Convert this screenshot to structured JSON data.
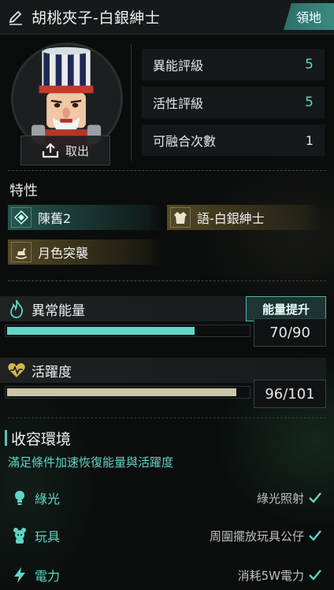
{
  "header": {
    "title": "胡桃夾子-白銀紳士",
    "territory_button": "領地"
  },
  "portrait": {
    "export_label": "取出"
  },
  "stats": [
    {
      "label": "異能評級",
      "value": "5",
      "accent": true
    },
    {
      "label": "活性評級",
      "value": "5",
      "accent": true
    },
    {
      "label": "可融合次數",
      "value": "1",
      "accent": false
    }
  ],
  "traits": {
    "section_label": "特性",
    "items": [
      {
        "label": "陳舊2",
        "style": "teal",
        "icon": "diamond-icon"
      },
      {
        "label": "語-白銀紳士",
        "style": "gold",
        "icon": "coat-icon"
      },
      {
        "label": "月色突襲",
        "style": "gold",
        "icon": "rocking-horse-icon"
      }
    ]
  },
  "anomaly_energy": {
    "label": "異常能量",
    "boost_button": "能量提升",
    "current": 70,
    "max": 90,
    "display": "70/90",
    "color": "#5fd6c6"
  },
  "activity": {
    "label": "活躍度",
    "current": 96,
    "max": 101,
    "display": "96/101",
    "color": "#c9c7a6"
  },
  "environment": {
    "title": "收容環境",
    "subtitle": "滿足條件加速恢復能量與活躍度",
    "items": [
      {
        "name": "綠光",
        "condition": "綠光照射",
        "icon": "lightbulb-icon"
      },
      {
        "name": "玩具",
        "condition": "周圍擺放玩具公仔",
        "icon": "toy-icon"
      },
      {
        "name": "電力",
        "condition": "消耗5W電力",
        "icon": "lightning-icon"
      }
    ]
  },
  "colors": {
    "accent": "#5fd6c6",
    "teal_button": "#3a8a82",
    "gold_tag": "#6e5f2d"
  }
}
